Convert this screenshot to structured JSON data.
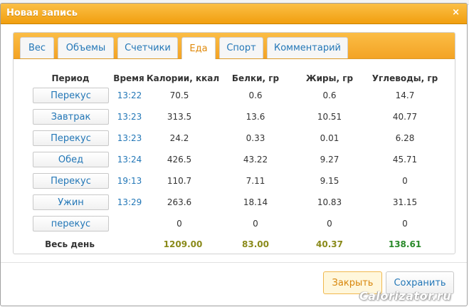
{
  "dialog": {
    "title": "Новая запись",
    "close_glyph": "×"
  },
  "tabs": [
    {
      "label": "Вес",
      "active": false
    },
    {
      "label": "Объемы",
      "active": false
    },
    {
      "label": "Счетчики",
      "active": false
    },
    {
      "label": "Еда",
      "active": true
    },
    {
      "label": "Спорт",
      "active": false
    },
    {
      "label": "Комментарий",
      "active": false
    }
  ],
  "table": {
    "headers": {
      "period": "Период",
      "time": "Время",
      "calories": "Калории, ккал",
      "proteins": "Белки, гр",
      "fats": "Жиры, гр",
      "carbs": "Углеводы, гр"
    },
    "rows": [
      {
        "period": "Перекус",
        "time": "13:22",
        "calories": "70.5",
        "proteins": "0.6",
        "fats": "0.6",
        "carbs": "14.7"
      },
      {
        "period": "Завтрак",
        "time": "13:23",
        "calories": "313.5",
        "proteins": "13.6",
        "fats": "10.51",
        "carbs": "40.77"
      },
      {
        "period": "Перекус",
        "time": "13:23",
        "calories": "24.2",
        "proteins": "0.33",
        "fats": "0.01",
        "carbs": "6.28"
      },
      {
        "period": "Обед",
        "time": "13:24",
        "calories": "426.5",
        "proteins": "43.22",
        "fats": "9.27",
        "carbs": "45.71"
      },
      {
        "period": "Перекус",
        "time": "19:13",
        "calories": "110.7",
        "proteins": "7.11",
        "fats": "9.15",
        "carbs": "0"
      },
      {
        "period": "Ужин",
        "time": "13:29",
        "calories": "263.6",
        "proteins": "18.14",
        "fats": "10.83",
        "carbs": "31.15"
      },
      {
        "period": "перекус",
        "time": "",
        "calories": "0",
        "proteins": "0",
        "fats": "0",
        "carbs": "0"
      }
    ],
    "totals": {
      "label": "Весь день",
      "calories": "1209.00",
      "proteins": "83.00",
      "fats": "40.37",
      "carbs": "138.61"
    }
  },
  "buttons": {
    "close_label": "Закрыть",
    "save_label": "Сохранить"
  },
  "watermark": "Calorizator.ru",
  "colors": {
    "accent_orange": "#f4a829",
    "link_blue": "#2377b7",
    "total_olive": "#8a8a1a",
    "total_green": "#2a8a2a"
  }
}
